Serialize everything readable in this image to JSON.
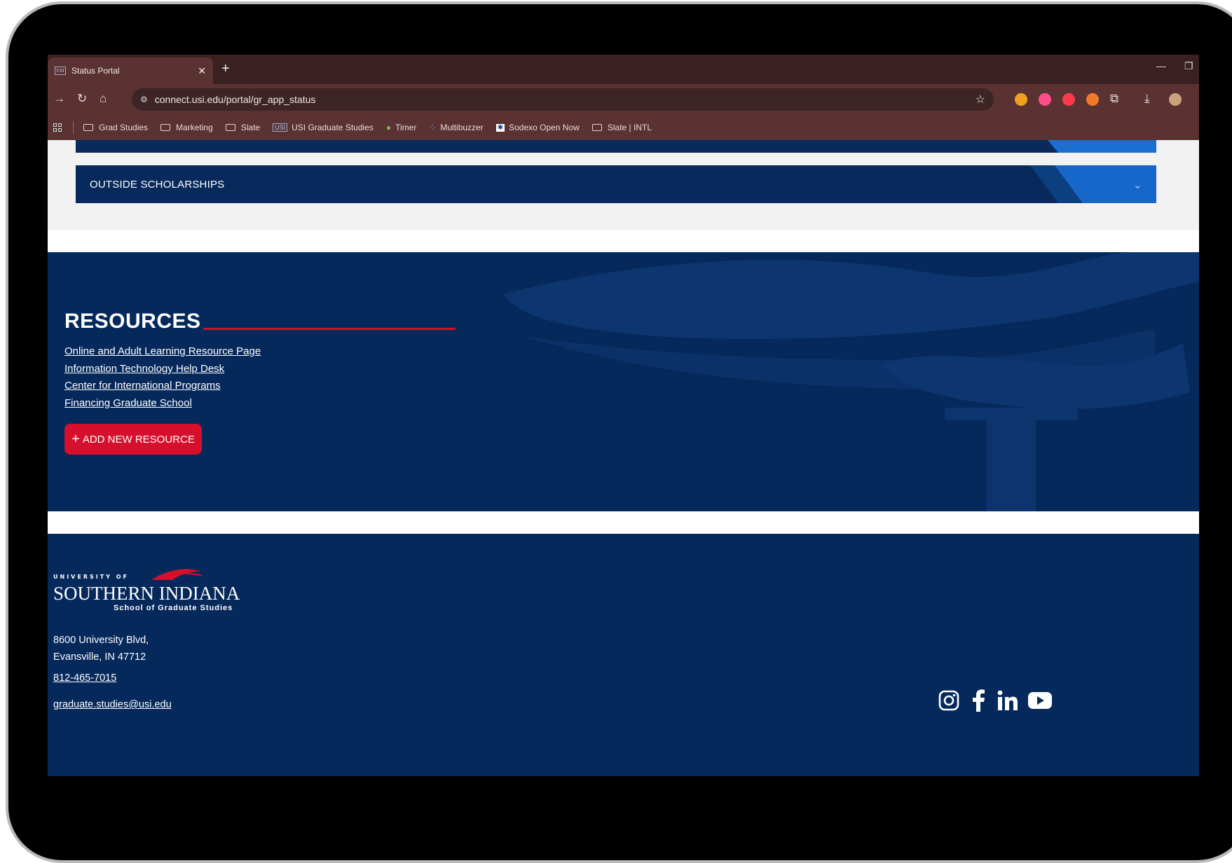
{
  "browser": {
    "tab_title": "Status Portal",
    "tab_favicon": "USI",
    "url": "connect.usi.edu/portal/gr_app_status",
    "bookmarks": [
      {
        "label": "Grad Studies",
        "icon": "folder-icon"
      },
      {
        "label": "Marketing",
        "icon": "folder-icon"
      },
      {
        "label": "Slate",
        "icon": "folder-icon"
      },
      {
        "label": "USI Graduate Studies",
        "icon": "usi-icon"
      },
      {
        "label": "Timer",
        "icon": "timer-icon"
      },
      {
        "label": "Multibuzzer",
        "icon": "multibuzzer-icon"
      },
      {
        "label": "Sodexo Open Now",
        "icon": "sodexo-icon"
      },
      {
        "label": "Slate | INTL",
        "icon": "folder-icon"
      }
    ]
  },
  "accordion": {
    "title": "OUTSIDE SCHOLARSHIPS"
  },
  "resources": {
    "title": "RESOURCES",
    "links": [
      "Online and Adult Learning Resource Page",
      "Information Technology Help Desk",
      "Center for International Programs",
      "Financing Graduate School"
    ],
    "add_button": "ADD NEW RESOURCE"
  },
  "footer": {
    "logo_top": "UNIVERSITY OF",
    "logo_main": "SOUTHERN INDIANA",
    "logo_sub": "School of Graduate Studies",
    "address_line1": "8600 University Blvd,",
    "address_line2": "Evansville, IN 47712",
    "phone": "812-465-7015",
    "email": "graduate.studies@usi.edu",
    "social": [
      "instagram-icon",
      "facebook-icon",
      "linkedin-icon",
      "youtube-icon"
    ]
  },
  "colors": {
    "navy": "#06295c",
    "red": "#d50f2c",
    "chrome": "#5a3232"
  }
}
